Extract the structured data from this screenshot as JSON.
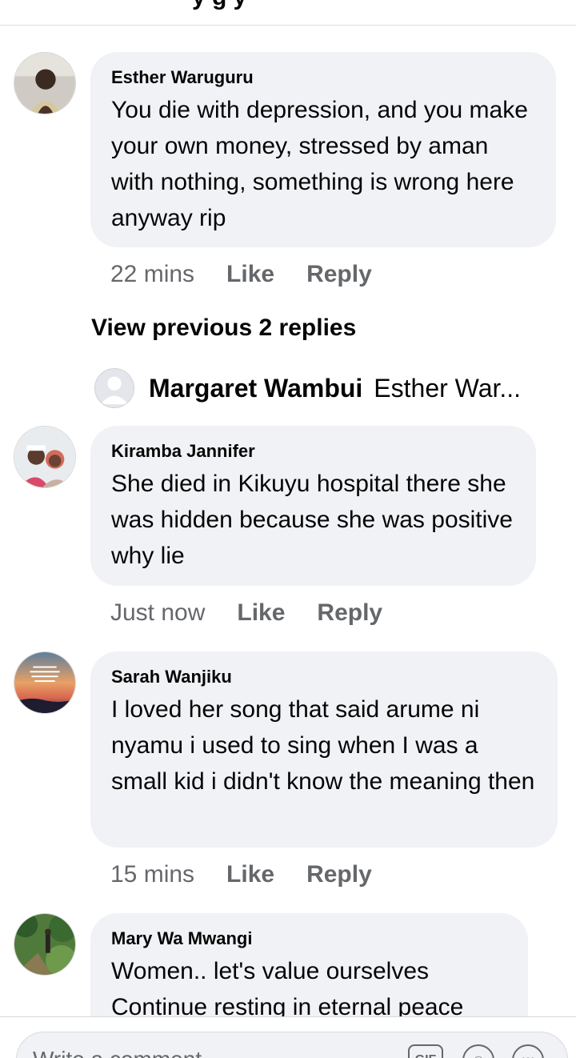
{
  "header": {
    "title_fragment": "y   g   y"
  },
  "comments": [
    {
      "author": "Esther Waruguru",
      "text": "You die with depression, and you make your own money, stressed by aman with nothing, something is wrong here anyway rip",
      "time": "22 mins",
      "like_label": "Like",
      "reply_label": "Reply"
    },
    {
      "author": "Kiramba Jannifer",
      "text": "She died in Kikuyu  hospital there she was hidden because she was positive why lie",
      "time": "Just now",
      "like_label": "Like",
      "reply_label": "Reply"
    },
    {
      "author": "Sarah Wanjiku",
      "text": "I loved her song that said arume ni nyamu  i used to sing when I was a small kid  i didn't know the meaning then",
      "time": "15 mins",
      "like_label": "Like",
      "reply_label": "Reply"
    },
    {
      "author": "Mary Wa Mwangi",
      "text": "Women.. let's value ourselves Continue resting in eternal peace"
    }
  ],
  "replies_thread": {
    "view_previous_label": "View previous 2 replies",
    "preview_name": "Margaret Wambui",
    "preview_snippet": "Esther War..."
  },
  "composer": {
    "placeholder": "Write a comment...",
    "gif_label": "GIF"
  },
  "colors": {
    "bubble": "#f0f2f5",
    "meta_text": "#65676b",
    "primary_text": "#050505"
  }
}
